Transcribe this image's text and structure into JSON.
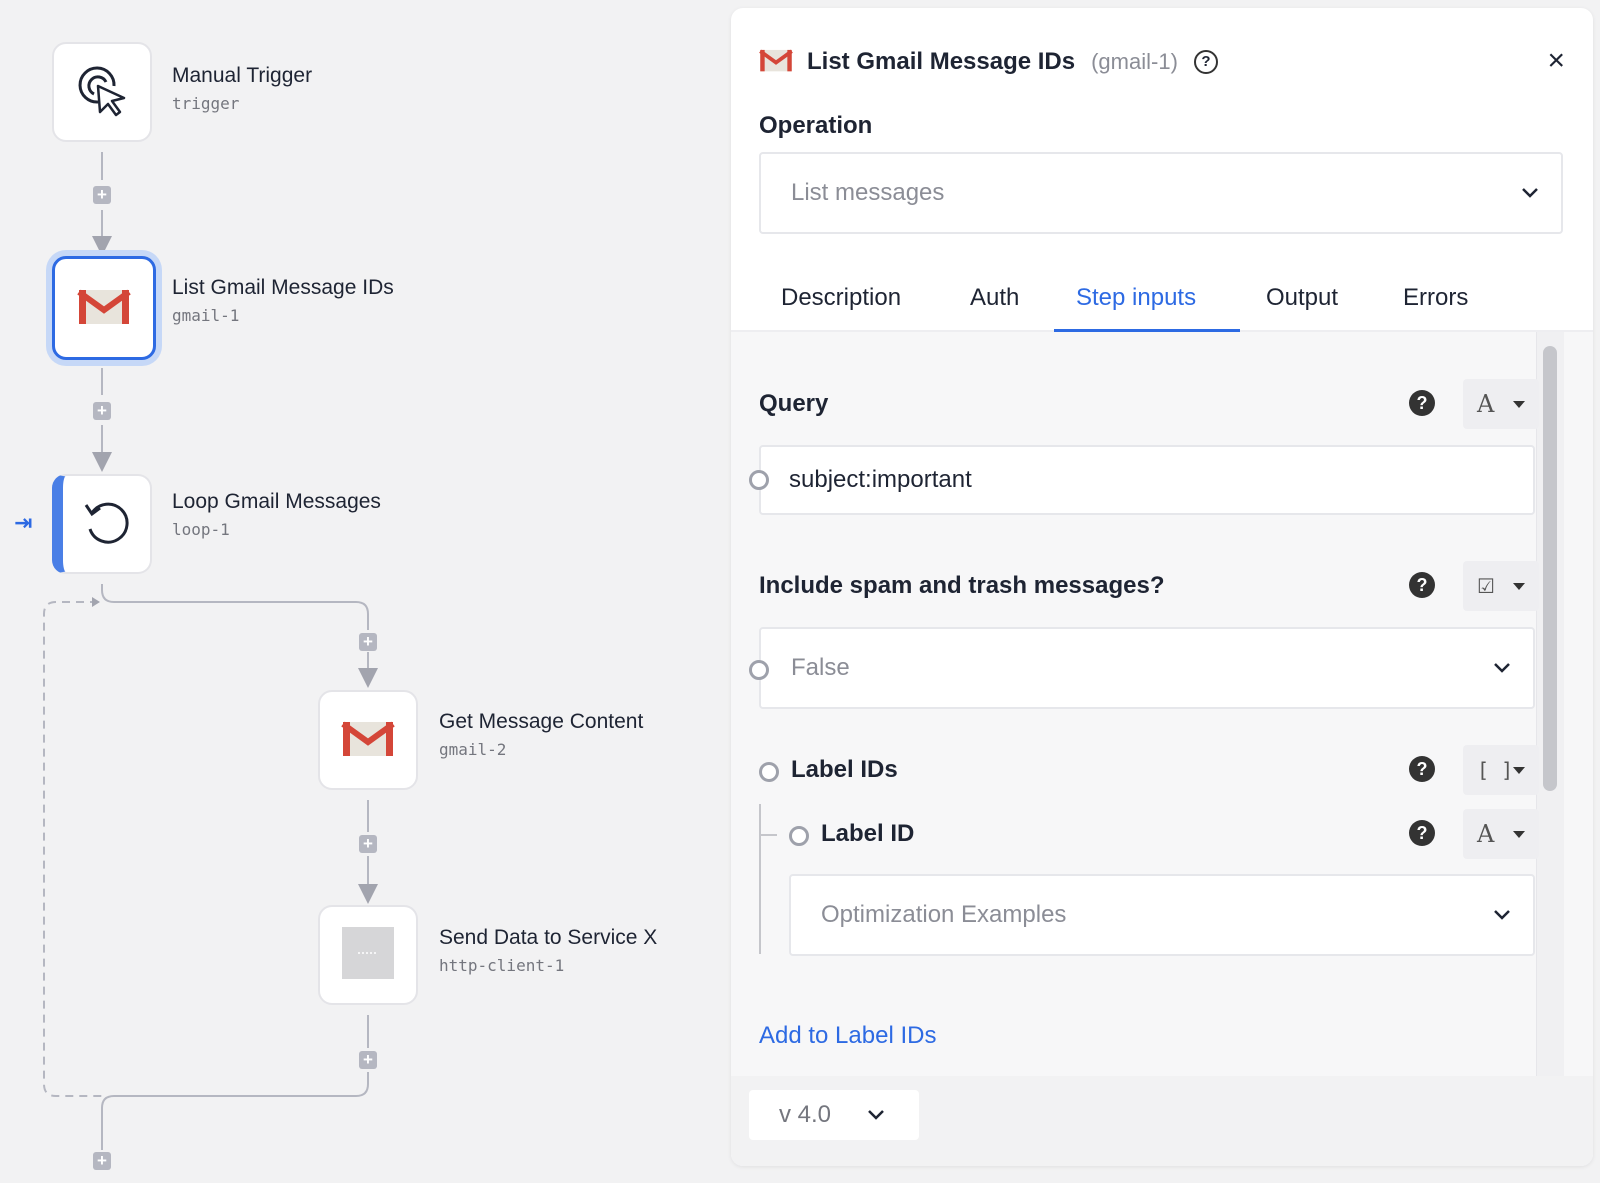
{
  "workflow": {
    "nodes": [
      {
        "title": "Manual Trigger",
        "key": "trigger",
        "icon": "cursor-click-icon"
      },
      {
        "title": "List Gmail Message IDs",
        "key": "gmail-1",
        "icon": "gmail-icon"
      },
      {
        "title": "Loop Gmail Messages",
        "key": "loop-1",
        "icon": "loop-icon"
      },
      {
        "title": "Get Message Content",
        "key": "gmail-2",
        "icon": "gmail-icon"
      },
      {
        "title": "Send Data to Service X",
        "key": "http-client-1",
        "icon": "http-client-icon"
      }
    ],
    "add_step_symbol": "+",
    "collapse_symbol": "⇥"
  },
  "panel": {
    "title": "List Gmail Message IDs",
    "key": "(gmail-1)",
    "help_symbol": "?",
    "close_symbol": "×",
    "operation_label": "Operation",
    "operation_value": "List messages",
    "tabs": [
      {
        "label": "Description"
      },
      {
        "label": "Auth"
      },
      {
        "label": "Step inputs",
        "active": true
      },
      {
        "label": "Output"
      },
      {
        "label": "Errors"
      }
    ],
    "fields": {
      "query": {
        "label": "Query",
        "value": "subject:important",
        "type_glyph": "A"
      },
      "include_spam": {
        "label": "Include spam and trash messages?",
        "value": "False",
        "type_glyph": "☑"
      },
      "label_ids": {
        "label": "Label IDs",
        "type_glyph": "[ ]"
      },
      "label_id": {
        "label": "Label ID",
        "value": "Optimization Examples",
        "type_glyph": "A"
      }
    },
    "help_mark": "?",
    "add_link": "Add to Label IDs",
    "version": "v 4.0"
  },
  "colors": {
    "accent": "#2d6ae3",
    "gmail_red": "#d44638"
  }
}
